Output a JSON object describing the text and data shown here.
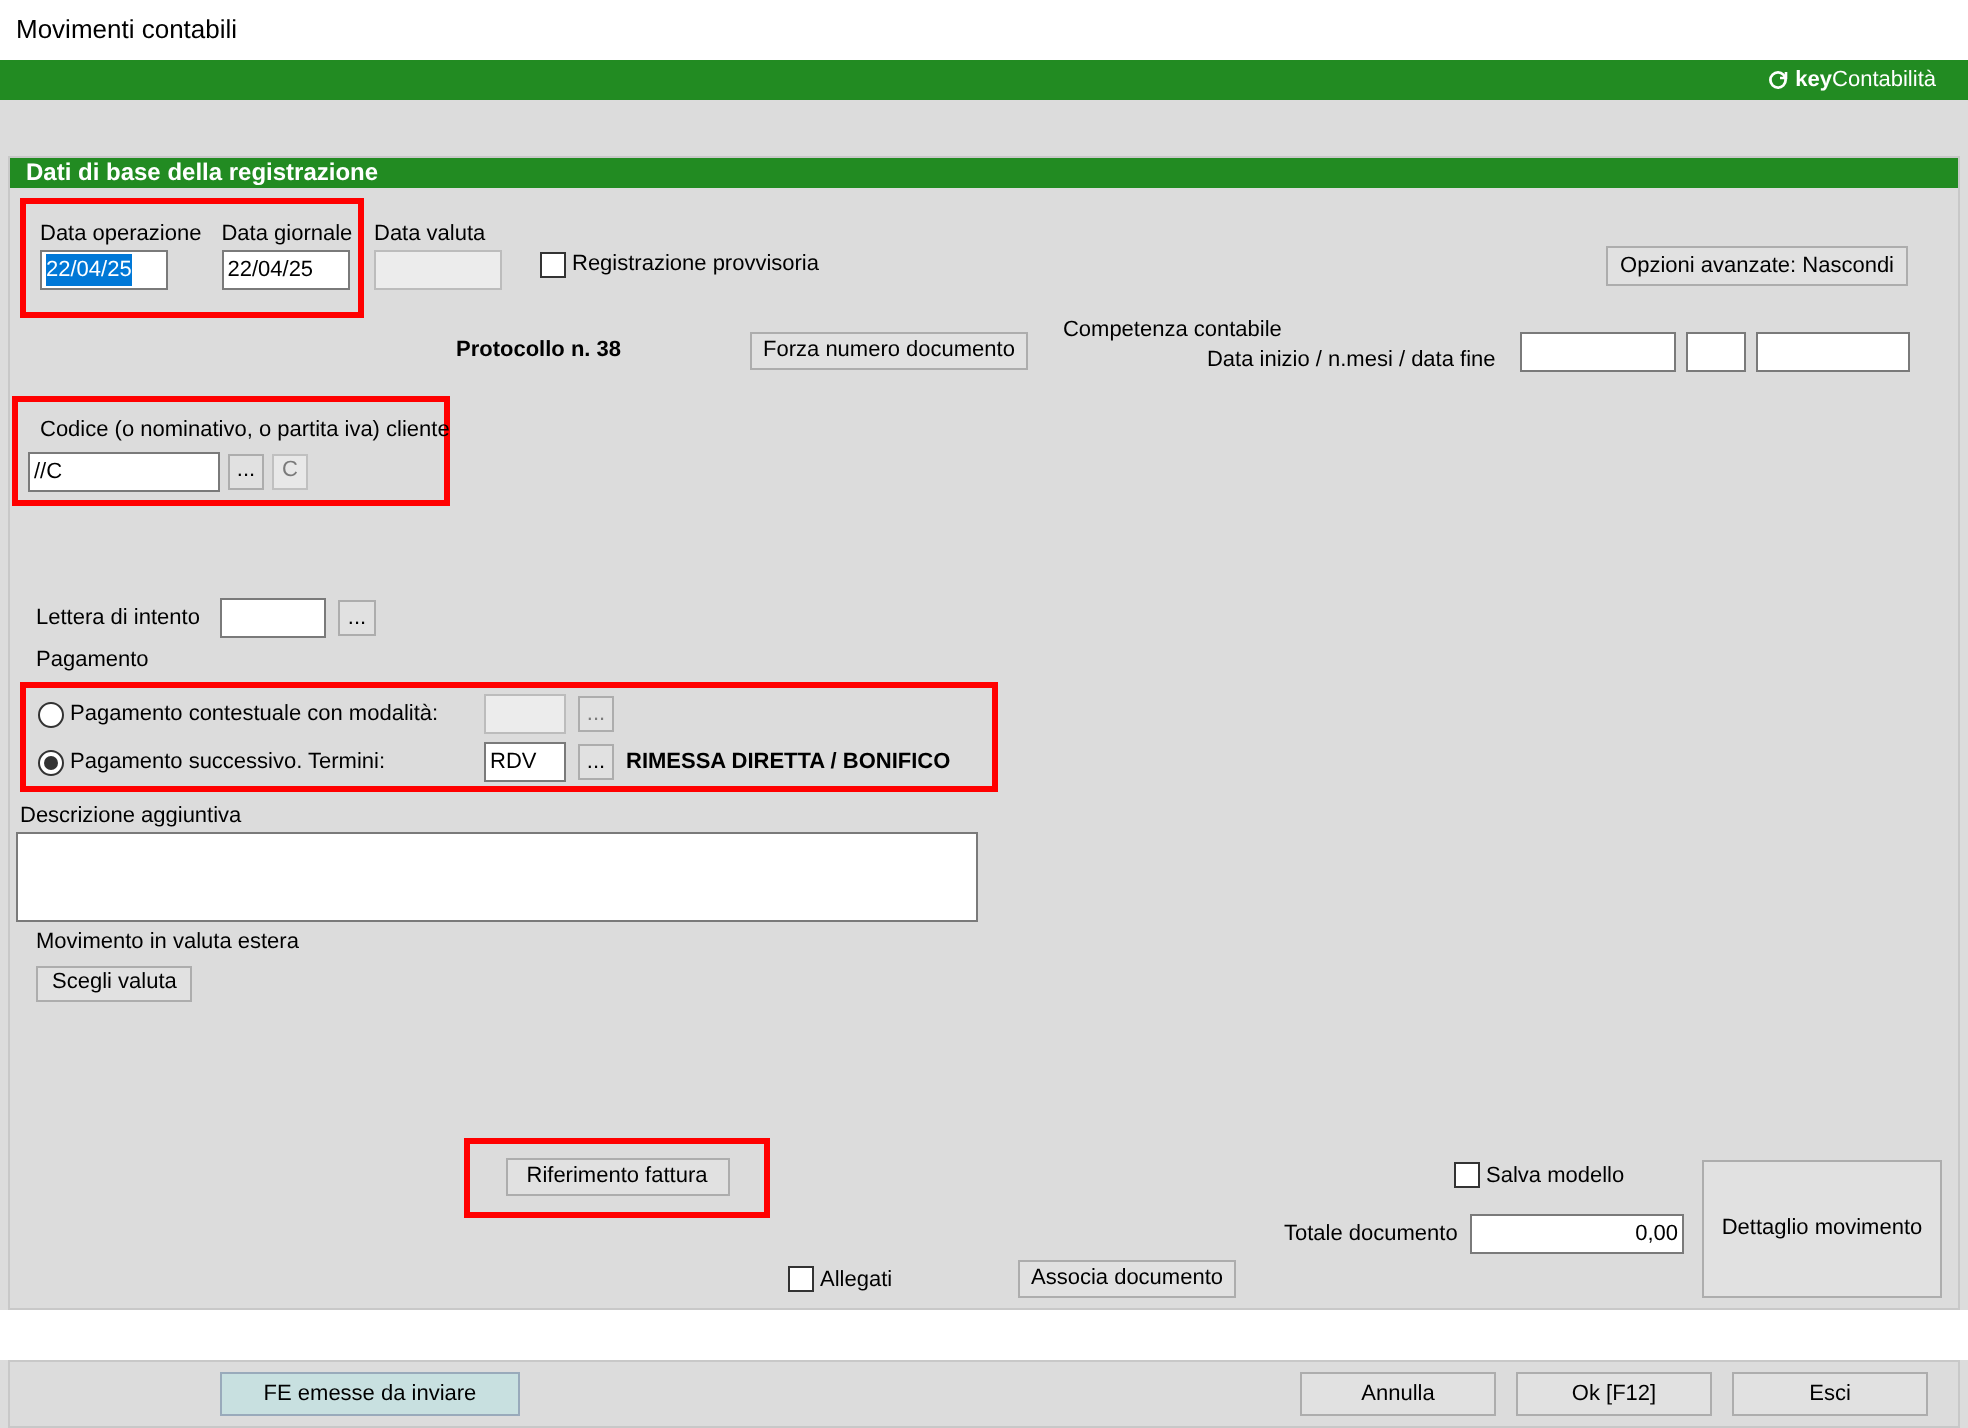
{
  "window": {
    "title": "Movimenti contabili"
  },
  "brand": {
    "prefix": "key",
    "name": "Contabilità"
  },
  "section": {
    "title": "Dati di base della registrazione"
  },
  "dates": {
    "highlighted": true,
    "fields": [
      {
        "label": "Data operazione",
        "value": "22/04/25",
        "text_selected": true
      },
      {
        "label": "Data giornale",
        "value": "22/04/25",
        "text_selected": false
      }
    ]
  },
  "data_valuta": {
    "label": "Data valuta",
    "disabled": true
  },
  "provvisoria": {
    "label": "Registrazione provvisoria",
    "checked": false
  },
  "advanced_button": "Opzioni avanzate: Nascondi",
  "protocollo": "Protocollo n. 38",
  "forza_button": "Forza numero documento",
  "competenza": {
    "title": "Competenza contabile",
    "label": "Data inizio / n.mesi / data fine"
  },
  "cliente": {
    "highlighted": true,
    "label": "Codice (o nominativo, o partita iva) cliente",
    "value": "//C",
    "browse": "...",
    "clear": {
      "label": "C",
      "disabled": true
    }
  },
  "lettera": {
    "label": "Lettera di intento",
    "browse": "..."
  },
  "pagamento": {
    "label": "Pagamento",
    "highlighted": true,
    "options": [
      {
        "label": "Pagamento contestuale con modalità:",
        "selected": false,
        "disabled": true,
        "browse": "..."
      },
      {
        "label": "Pagamento successivo. Termini:",
        "selected": true,
        "disabled": false,
        "value": "RDV",
        "browse": "...",
        "description": "RIMESSA DIRETTA / BONIFICO"
      }
    ]
  },
  "descrizione": {
    "label": "Descrizione aggiuntiva"
  },
  "valuta": {
    "label": "Movimento in valuta estera",
    "button": "Scegli valuta"
  },
  "riferimento": {
    "button": "Riferimento fattura",
    "highlighted": true
  },
  "salva": {
    "label": "Salva modello",
    "checked": false
  },
  "totale": {
    "label": "Totale documento",
    "value": "0,00"
  },
  "dettaglio_button": "Dettaglio movimento",
  "allegati": {
    "label": "Allegati",
    "checked": false
  },
  "associa_button": "Associa documento",
  "footer": {
    "fe_button": "FE emesse da inviare",
    "buttons": [
      "Annulla",
      "Ok [F12]",
      "Esci"
    ]
  }
}
